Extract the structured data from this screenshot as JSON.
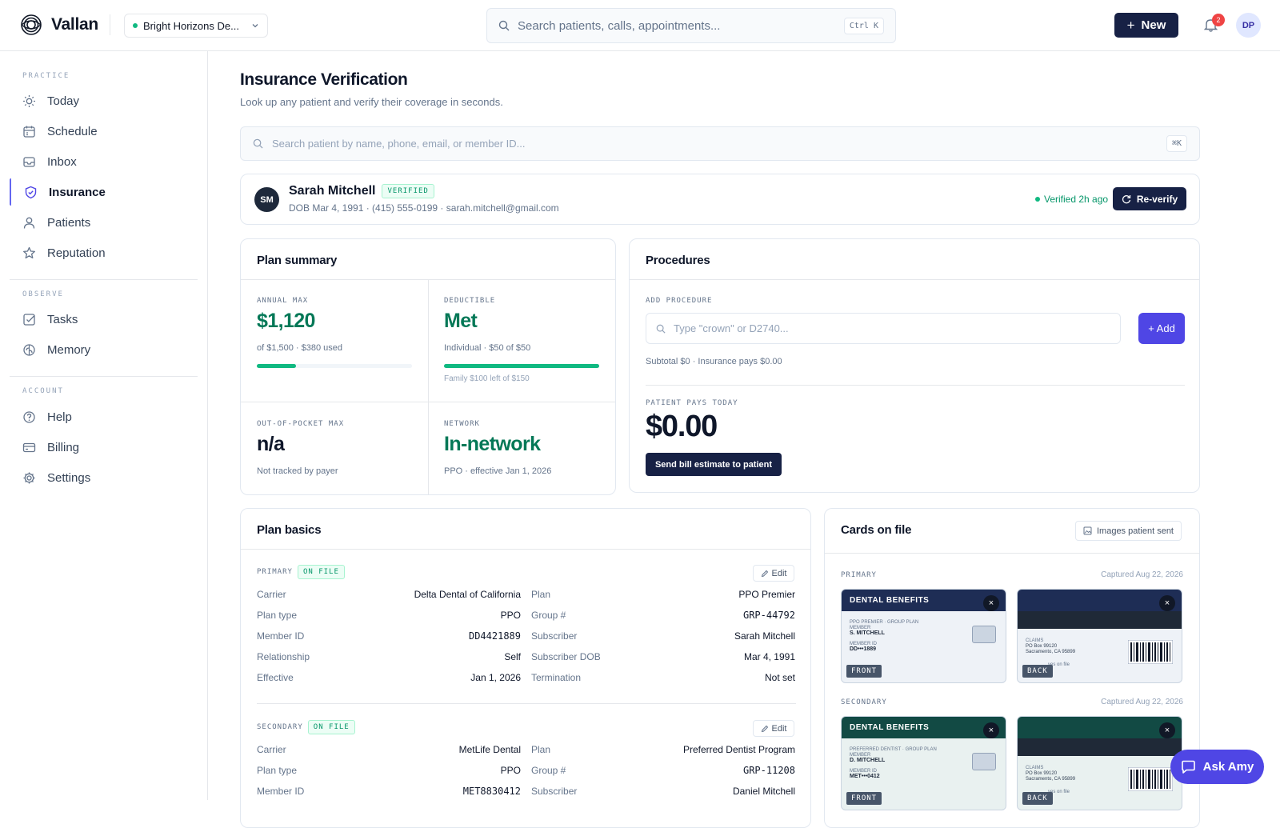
{
  "app": {
    "name": "Vallan",
    "practice": "Bright Horizons De..."
  },
  "search": {
    "placeholder": "Search patients, calls, appointments...",
    "shortcut": "Ctrl K"
  },
  "header": {
    "new_label": "New",
    "notifications": "2",
    "avatar": "DP"
  },
  "sidebar": {
    "sections": [
      {
        "label": "PRACTICE"
      },
      {
        "label": "OBSERVE"
      },
      {
        "label": "ACCOUNT"
      }
    ],
    "items": [
      {
        "label": "Today",
        "icon": "sun-icon"
      },
      {
        "label": "Schedule",
        "icon": "calendar-icon"
      },
      {
        "label": "Inbox",
        "icon": "inbox-icon"
      },
      {
        "label": "Insurance",
        "icon": "shield-check-icon",
        "active": true
      },
      {
        "label": "Patients",
        "icon": "user-icon"
      },
      {
        "label": "Reputation",
        "icon": "star-icon"
      },
      {
        "label": "Tasks",
        "icon": "checkbox-icon"
      },
      {
        "label": "Memory",
        "icon": "brain-icon"
      },
      {
        "label": "Help",
        "icon": "help-circle-icon"
      },
      {
        "label": "Billing",
        "icon": "credit-card-icon"
      },
      {
        "label": "Settings",
        "icon": "gear-icon"
      }
    ]
  },
  "page": {
    "title": "Insurance Verification",
    "subtitle": "Look up any patient and verify their coverage in seconds."
  },
  "patient_search": {
    "placeholder": "Search patient by name, phone, email, or member ID...",
    "shortcut": "⌘K"
  },
  "patient": {
    "initials": "SM",
    "name": "Sarah Mitchell",
    "badge": "VERIFIED",
    "meta": "DOB Mar 4, 1991 · (415) 555-0199 · sarah.mitchell@gmail.com",
    "verified_ago": "Verified 2h ago",
    "reverify_label": "Re-verify"
  },
  "plan_summary": {
    "title": "Plan summary",
    "annual_max": {
      "label": "ANNUAL MAX",
      "value": "$1,120",
      "detail": "of $1,500 · $380 used",
      "progress": 0.253
    },
    "deductible": {
      "label": "DEDUCTIBLE",
      "value": "Met",
      "detail": "Individual · $50 of $50",
      "progress": 1.0,
      "family": "Family $100 left of $150"
    },
    "oop": {
      "label": "OUT-OF-POCKET MAX",
      "value": "n/a",
      "detail": "Not tracked by payer"
    },
    "network": {
      "label": "NETWORK",
      "value": "In-network",
      "detail": "PPO · effective Jan 1, 2026"
    }
  },
  "procedures": {
    "title": "Procedures",
    "add_label": "ADD PROCEDURE",
    "input_placeholder": "Type \"crown\" or D2740...",
    "add_button": "+ Add",
    "subtotal": "Subtotal $0 · Insurance pays $0.00",
    "pays_label": "PATIENT PAYS TODAY",
    "pays_value": "$0.00",
    "send_button": "Send bill estimate to patient"
  },
  "plan_basics": {
    "title": "Plan basics",
    "edit_label": "Edit",
    "primary": {
      "label": "PRIMARY",
      "badge": "ON FILE",
      "left": [
        {
          "k": "Carrier",
          "v": "Delta Dental of California"
        },
        {
          "k": "Plan type",
          "v": "PPO"
        },
        {
          "k": "Member ID",
          "v": "DD4421889"
        },
        {
          "k": "Relationship",
          "v": "Self"
        },
        {
          "k": "Effective",
          "v": "Jan 1, 2026"
        }
      ],
      "right": [
        {
          "k": "Plan",
          "v": "PPO Premier"
        },
        {
          "k": "Group #",
          "v": "GRP-44792"
        },
        {
          "k": "Subscriber",
          "v": "Sarah Mitchell"
        },
        {
          "k": "Subscriber DOB",
          "v": "Mar 4, 1991"
        },
        {
          "k": "Termination",
          "v": "Not set"
        }
      ]
    },
    "secondary": {
      "label": "SECONDARY",
      "badge": "ON FILE",
      "left": [
        {
          "k": "Carrier",
          "v": "MetLife Dental"
        },
        {
          "k": "Plan type",
          "v": "PPO"
        },
        {
          "k": "Member ID",
          "v": "MET8830412"
        }
      ],
      "right": [
        {
          "k": "Plan",
          "v": "Preferred Dentist Program"
        },
        {
          "k": "Group #",
          "v": "GRP-11208"
        },
        {
          "k": "Subscriber",
          "v": "Daniel Mitchell"
        }
      ]
    }
  },
  "cards": {
    "title": "Cards on file",
    "images_button": "Images patient sent",
    "primary": {
      "label": "PRIMARY",
      "captured": "Captured Aug 22, 2026",
      "front_title": "DENTAL BENEFITS",
      "front_tag": "FRONT",
      "back_tag": "BACK",
      "front_plan": "PPO PREMIER · GROUP PLAN",
      "front_member_label": "MEMBER",
      "front_member": "S. MITCHELL",
      "front_id_label": "MEMBER ID",
      "front_id": "DD•••1889",
      "back_claims": "CLAIMS",
      "back_addr1": "PO Box 99120",
      "back_addr2": "Sacramento, CA 95899",
      "back_note": "ves on file"
    },
    "secondary": {
      "label": "SECONDARY",
      "captured": "Captured Aug 22, 2026",
      "front_title": "DENTAL BENEFITS",
      "front_tag": "FRONT",
      "back_tag": "BACK",
      "front_plan": "PREFERRED DENTIST · GROUP PLAN",
      "front_member_label": "MEMBER",
      "front_member": "D. MITCHELL",
      "front_id_label": "MEMBER ID",
      "front_id": "MET•••0412",
      "back_claims": "CLAIMS",
      "back_addr1": "PO Box 99120",
      "back_addr2": "Sacramento, CA 95899",
      "back_note": "ves on file"
    }
  },
  "assistant": {
    "label": "Ask Amy"
  },
  "colors": {
    "navy": "#172145",
    "indigo": "#4f46e5",
    "green": "#059669",
    "progress": "#10b981",
    "badge_red": "#ef4444"
  }
}
